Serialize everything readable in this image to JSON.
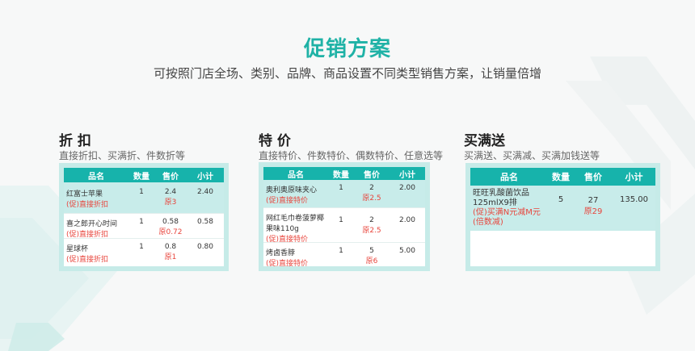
{
  "header": {
    "title": "促销方案",
    "subtitle": "可按照门店全场、类别、品牌、商品设置不同类型销售方案，让销量倍增"
  },
  "columns": {
    "name": "品名",
    "qty": "数量",
    "price": "售价",
    "subtotal": "小计"
  },
  "sections": [
    {
      "title": "折 扣",
      "desc": "直接折扣、买满折、件数折等",
      "rows": [
        {
          "name": "红富士苹果",
          "promo": "(促)直接折扣",
          "qty": "1",
          "price": "2.4",
          "orig": "原3",
          "subtotal": "2.40"
        },
        {
          "name": "喜之郎开心时间",
          "promo": "(促)直接折扣",
          "qty": "1",
          "price": "0.58",
          "orig": "原0.72",
          "subtotal": "0.58"
        },
        {
          "name": "星球杯",
          "promo": "(促)直接折扣",
          "qty": "1",
          "price": "0.8",
          "orig": "原1",
          "subtotal": "0.80"
        }
      ]
    },
    {
      "title": "特 价",
      "desc": "直接特价、件数特价、偶数特价、任意选等",
      "rows": [
        {
          "name": "奥利奥原味夹心",
          "promo": "(促)直接特价",
          "qty": "1",
          "price": "2",
          "orig": "原2.5",
          "subtotal": "2.00"
        },
        {
          "name": "网红毛巾卷菠萝椰果味110g",
          "promo": "(促)直接特价",
          "qty": "1",
          "price": "2",
          "orig": "原2.5",
          "subtotal": "2.00"
        },
        {
          "name": "烤卤香脖",
          "promo": "(促)直接特价",
          "qty": "1",
          "price": "5",
          "orig": "原6",
          "subtotal": "5.00"
        }
      ]
    },
    {
      "title": "买满送",
      "desc": "买满送、买满减、买满加钱送等",
      "rows": [
        {
          "name": "旺旺乳酸菌饮品125mlX9排",
          "promo": "(促)买满N元减M元(倍数减)",
          "qty": "5",
          "price": "27",
          "orig": "原29",
          "subtotal": "135.00"
        }
      ]
    }
  ],
  "colors": {
    "accent": "#1fb2a6",
    "table_header": "#17b3ab",
    "card_bg": "#c6ebe8",
    "promo_red": "#e8453c"
  }
}
